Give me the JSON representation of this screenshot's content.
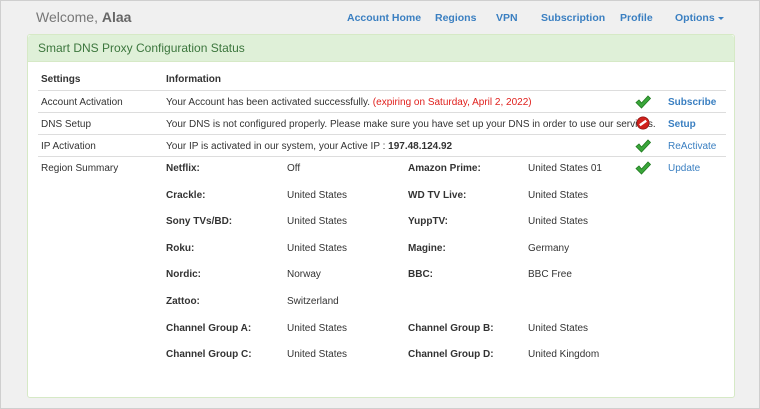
{
  "header": {
    "welcome_prefix": "Welcome,",
    "username": "Alaa",
    "nav": {
      "account_home": "Account Home",
      "regions": "Regions",
      "vpn": "VPN",
      "subscription": "Subscription",
      "profile": "Profile",
      "options": "Options"
    }
  },
  "panel": {
    "title": "Smart DNS Proxy Configuration Status",
    "columns": {
      "settings": "Settings",
      "information": "Information"
    },
    "rows": {
      "account": {
        "setting": "Account Activation",
        "info": "Your Account has been activated successfully.",
        "expiry": "(expiring on Saturday, April 2, 2022)",
        "status_icon": "check-icon",
        "action": "Subscribe"
      },
      "dns": {
        "setting": "DNS Setup",
        "info": "Your DNS is not configured properly. Please make sure you have set up your DNS in order to use our services.",
        "status_icon": "error-icon",
        "action": "Setup"
      },
      "ip": {
        "setting": "IP Activation",
        "info": "Your IP is activated in our system, your Active IP :",
        "ip_address": "197.48.124.92",
        "status_icon": "check-icon",
        "action": "ReActivate"
      },
      "region": {
        "setting": "Region Summary",
        "status_icon": "check-icon",
        "action": "Update"
      }
    },
    "regions": [
      {
        "label": "Netflix:",
        "value": "Off"
      },
      {
        "label": "Amazon Prime:",
        "value": "United States 01"
      },
      {
        "label": "Crackle:",
        "value": "United States"
      },
      {
        "label": "WD TV Live:",
        "value": "United States"
      },
      {
        "label": "Sony TVs/BD:",
        "value": "United States"
      },
      {
        "label": "YuppTV:",
        "value": "United States"
      },
      {
        "label": "Roku:",
        "value": "United States"
      },
      {
        "label": "Magine:",
        "value": "Germany"
      },
      {
        "label": "Nordic:",
        "value": "Norway"
      },
      {
        "label": "BBC:",
        "value": "BBC Free"
      },
      {
        "label": "Zattoo:",
        "value": "Switzerland"
      },
      {
        "label": "Channel Group A:",
        "value": "United States"
      },
      {
        "label": "Channel Group B:",
        "value": "United States"
      },
      {
        "label": "Channel Group C:",
        "value": "United States"
      },
      {
        "label": "Channel Group D:",
        "value": "United Kingdom"
      }
    ],
    "colors": {
      "success": "#2a9d2a",
      "error": "#c9201b",
      "link": "#3a7fc1",
      "expiry": "#e0201d"
    }
  }
}
